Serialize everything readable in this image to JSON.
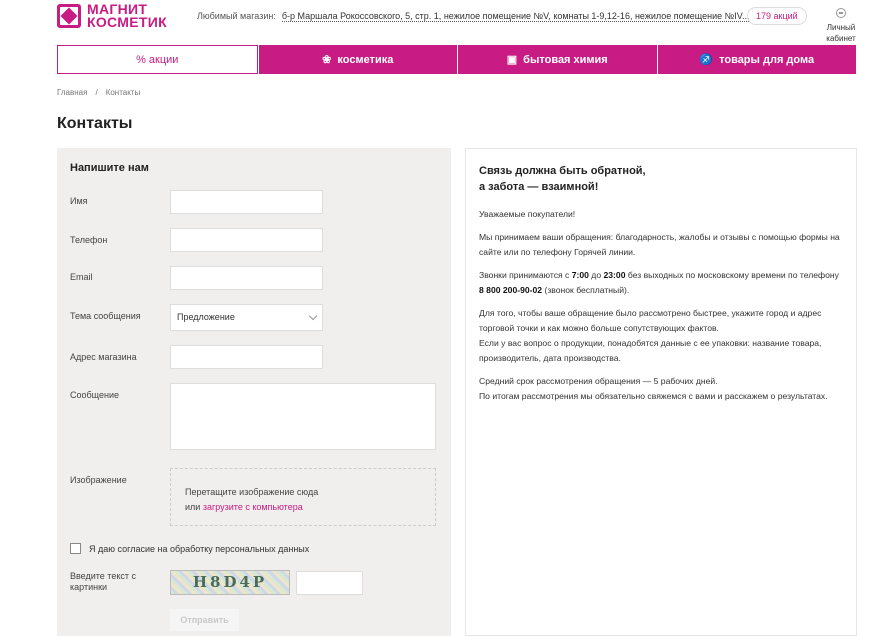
{
  "header": {
    "logo_line1": "МАГНИТ",
    "logo_line2": "КОСМЕТИК",
    "favorite_shop_label": "Любимый магазин:",
    "favorite_shop_address": "б-р Маршала Рокоссовского, 5, стр. 1, нежилое помещение №V, комнаты 1-9,12-16, нежилое помещение №IV...",
    "promo_badge": "179 акций",
    "account_line1": "Личный",
    "account_line2": "кабинет"
  },
  "nav": {
    "items": [
      {
        "label": "% акции",
        "icon": ""
      },
      {
        "label": "косметика",
        "icon": "cosmetics-icon"
      },
      {
        "label": "бытовая химия",
        "icon": "household-chemicals-icon"
      },
      {
        "label": "товары для дома",
        "icon": "home-goods-icon"
      }
    ]
  },
  "breadcrumb": {
    "home": "Главная",
    "separator": "/",
    "current": "Контакты"
  },
  "page_title": "Контакты",
  "form": {
    "title": "Напишите нам",
    "name_label": "Имя",
    "phone_label": "Телефон",
    "email_label": "Email",
    "subject_label": "Тема сообщения",
    "subject_value": "Предложение",
    "store_address_label": "Адрес магазина",
    "message_label": "Сообщение",
    "image_label": "Изображение",
    "dropzone_text": "Перетащите изображение сюда",
    "dropzone_or": "или",
    "dropzone_link": "загрузите с компьютера",
    "consent_text": "Я даю согласие на обработку персональных данных",
    "captcha_label_line1": "Введите текст с",
    "captcha_label_line2": "картинки",
    "captcha_text": "H8D4P",
    "submit_label": "Отправить"
  },
  "info": {
    "heading_line1": "Связь должна быть обратной,",
    "heading_line2": "а забота — взаимной!",
    "greeting": "Уважаемые покупатели!",
    "p1": "Мы принимаем ваши обращения: благодарность, жалобы и отзывы с помощью формы на сайте или по телефону Горячей линии.",
    "calls_prefix": "Звонки принимаются с ",
    "calls_from": "7:00",
    "calls_to_word": " до ",
    "calls_to": "23:00",
    "calls_suffix": " без выходных по московскому времени по телефону ",
    "phone": "8 800 200-90-02",
    "phone_note": " (звонок бесплатный).",
    "p3a": "Для того, чтобы ваше обращение было рассмотрено быстрее, укажите город и адрес торговой точки и как можно больше сопутствующих фактов.",
    "p3b": "Если у вас вопрос о продукции, понадобятся данные с ее упаковки: название товара, производитель, дата производства.",
    "p4a": "Средний срок рассмотрения обращения — 5 рабочих дней.",
    "p4b": "По итогам рассмотрения мы обязательно свяжемся с вами и расскажем о результатах."
  },
  "colors": {
    "brand": "#c81c84"
  }
}
